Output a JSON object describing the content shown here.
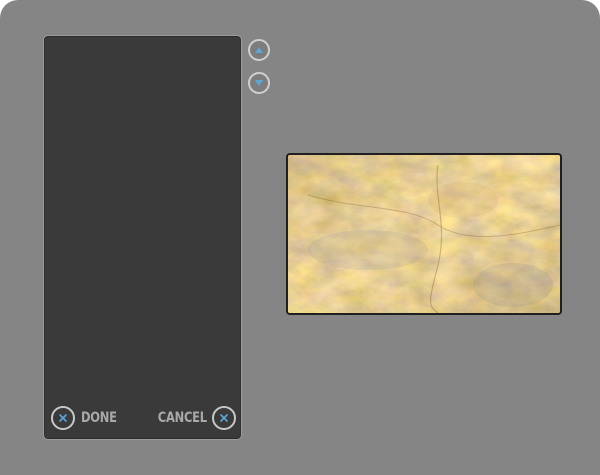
{
  "panel": {
    "done_label": "DONE",
    "cancel_label": "CANCEL"
  },
  "icons": {
    "scroll_up": "arrow-up-icon",
    "scroll_down": "arrow-down-icon",
    "done": "close-icon",
    "cancel": "close-icon"
  },
  "colors": {
    "background": "#858585",
    "panel": "#3a3a3a",
    "accent_icon": "#5aa7d8",
    "button_ring": "#cfcfcf",
    "label": "#a9a9a9"
  },
  "preview": {
    "image": "golden-leaf-texture"
  }
}
